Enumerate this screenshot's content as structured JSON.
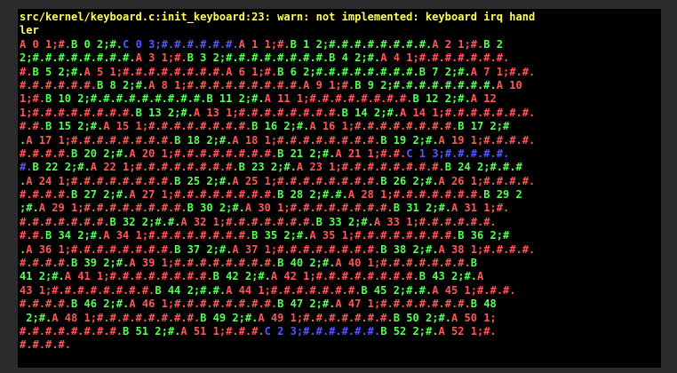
{
  "window": {
    "title": ""
  },
  "colors": {
    "background": "#000000",
    "frame": "#2b2b2b",
    "warn": "#ffff55",
    "task_a": "#ff5555",
    "task_b": "#55ff55",
    "task_c": "#5555ff"
  },
  "console": {
    "lines": [
      [
        {
          "t": "src/kernel/keyboard.c:init_keyboard:23: warn: not implemented: keyboard irq hand",
          "c": "warn"
        }
      ],
      [
        {
          "t": "ler",
          "c": "warn"
        }
      ],
      [
        {
          "t": "A 0 1;#.",
          "c": "r"
        },
        {
          "t": "B 0 2;#.",
          "c": "g"
        },
        {
          "t": "C 0 3;#.#.#.#.#.#.",
          "c": "b"
        },
        {
          "t": "A 1 1;#.",
          "c": "r"
        },
        {
          "t": "B 1 2;#.#.#.#.#.#.#.#.",
          "c": "g"
        },
        {
          "t": "A 2 1;#.",
          "c": "r"
        },
        {
          "t": "B 2",
          "c": "g"
        }
      ],
      [
        {
          "t": "2;#.#.#.#.#.#.#.#.",
          "c": "g"
        },
        {
          "t": "A 3 1;#.",
          "c": "r"
        },
        {
          "t": "B 3 2;#.#.#.#.#.#.#.#.",
          "c": "g"
        },
        {
          "t": "B 4 2;#.",
          "c": "g"
        },
        {
          "t": "A 4 1;#.#.#.#.#.#.#.",
          "c": "r"
        }
      ],
      [
        {
          "t": "#.",
          "c": "r"
        },
        {
          "t": "B 5 2;#.",
          "c": "g"
        },
        {
          "t": "A 5 1;#.#.#.#.#.#.#.#.",
          "c": "r"
        },
        {
          "t": "A 6 1;#.",
          "c": "r"
        },
        {
          "t": "B 6 2;#.#.#.#.#.#.#.#.",
          "c": "g"
        },
        {
          "t": "B 7 2;#.",
          "c": "g"
        },
        {
          "t": "A 7 1;#.#.",
          "c": "r"
        }
      ],
      [
        {
          "t": "#.#.#.#.#.#.",
          "c": "r"
        },
        {
          "t": "B 8 2;#.",
          "c": "g"
        },
        {
          "t": "A 8 1;#.#.#.#.#.#.#.#.#.",
          "c": "r"
        },
        {
          "t": "A 9 1;#.",
          "c": "r"
        },
        {
          "t": "B 9 2;#.#.#.#.#.#.#.#.",
          "c": "g"
        },
        {
          "t": "A 10",
          "c": "r"
        }
      ],
      [
        {
          "t": "1;#.",
          "c": "r"
        },
        {
          "t": "B 10 2;#.#.#.#.#.#.#.#.#.",
          "c": "g"
        },
        {
          "t": "B 11 2;#.",
          "c": "g"
        },
        {
          "t": "A 11 1;#.#.#.#.#.#.#.#.",
          "c": "r"
        },
        {
          "t": "B 12 2;#.",
          "c": "g"
        },
        {
          "t": "A 12",
          "c": "r"
        }
      ],
      [
        {
          "t": "1;#.#.#.#.#.#.#.#.",
          "c": "r"
        },
        {
          "t": "B 13 2;#.",
          "c": "g"
        },
        {
          "t": "A 13 1;#.#.#.#.#.#.#.#.",
          "c": "r"
        },
        {
          "t": "B 14 2;#.",
          "c": "g"
        },
        {
          "t": "A 14 1;#.#.#.#.#.#.#.",
          "c": "r"
        }
      ],
      [
        {
          "t": "#.#.",
          "c": "r"
        },
        {
          "t": "B 15 2;#.",
          "c": "g"
        },
        {
          "t": "A 15 1;#.#.#.#.#.#.#.#.",
          "c": "r"
        },
        {
          "t": "B 16 2;#.",
          "c": "g"
        },
        {
          "t": "A 16 1;#.#.#.#.#.#.#.#.",
          "c": "r"
        },
        {
          "t": "B 17 2;#",
          "c": "g"
        }
      ],
      [
        {
          "t": ".",
          "c": "g"
        },
        {
          "t": "A 17 1;#.#.#.#.#.#.#.#.",
          "c": "r"
        },
        {
          "t": "B 18 2;#.",
          "c": "g"
        },
        {
          "t": "A 18 1;#.#.#.#.#.#.#.#.",
          "c": "r"
        },
        {
          "t": "B 19 2;#.",
          "c": "g"
        },
        {
          "t": "A 19 1;#.#.#.#.",
          "c": "r"
        }
      ],
      [
        {
          "t": "#.#.#.#.",
          "c": "r"
        },
        {
          "t": "B 20 2;#.",
          "c": "g"
        },
        {
          "t": "A 20 1;#.#.#.#.#.#.#.#.",
          "c": "r"
        },
        {
          "t": "B 21 2;#.",
          "c": "g"
        },
        {
          "t": "A 21 1;#.#.",
          "c": "r"
        },
        {
          "t": "C 1 3;#.#.#.#.#.",
          "c": "b"
        }
      ],
      [
        {
          "t": "#.",
          "c": "b"
        },
        {
          "t": "B 22 2;#.",
          "c": "g"
        },
        {
          "t": "A 22 1;#.#.#.#.#.#.#.#.",
          "c": "r"
        },
        {
          "t": "B 23 2;#.",
          "c": "g"
        },
        {
          "t": "A 23 1;#.#.#.#.#.#.#.#.",
          "c": "r"
        },
        {
          "t": "B 24 2;#.#.#",
          "c": "g"
        }
      ],
      [
        {
          "t": ".",
          "c": "g"
        },
        {
          "t": "A 24 1;#.#.#.#.#.#.#.#.",
          "c": "r"
        },
        {
          "t": "B 25 2;#.",
          "c": "g"
        },
        {
          "t": "A 25 1;#.#.#.#.#.#.#.#.",
          "c": "r"
        },
        {
          "t": "B 26 2;#.",
          "c": "g"
        },
        {
          "t": "A 26 1;#.#.#.#.",
          "c": "r"
        }
      ],
      [
        {
          "t": "#.#.#.#.",
          "c": "r"
        },
        {
          "t": "B 27 2;#.",
          "c": "g"
        },
        {
          "t": "A 27 1;#.#.#.#.#.#.#.#.",
          "c": "r"
        },
        {
          "t": "B 28 2;#.#.",
          "c": "g"
        },
        {
          "t": "A 28 1;#.#.#.#.#.#.#.",
          "c": "r"
        },
        {
          "t": "B 29 2",
          "c": "g"
        }
      ],
      [
        {
          "t": ";#.",
          "c": "g"
        },
        {
          "t": "A 29 1;#.#.#.#.#.#.#.#.",
          "c": "r"
        },
        {
          "t": "B 30 2;#.",
          "c": "g"
        },
        {
          "t": "A 30 1;#.#.#.#.#.#.#.#.",
          "c": "r"
        },
        {
          "t": "B 31 2;#.",
          "c": "g"
        },
        {
          "t": "A 31 1;#.",
          "c": "r"
        }
      ],
      [
        {
          "t": "#.#.#.#.#.#.#.",
          "c": "r"
        },
        {
          "t": "B 32 2;#.#.",
          "c": "g"
        },
        {
          "t": "A 32 1;#.#.#.#.#.#.#.",
          "c": "r"
        },
        {
          "t": "B 33 2;#.",
          "c": "g"
        },
        {
          "t": "A 33 1;#.#.#.#.#.#.",
          "c": "r"
        }
      ],
      [
        {
          "t": "#.#.",
          "c": "r"
        },
        {
          "t": "B 34 2;#.",
          "c": "g"
        },
        {
          "t": "A 34 1;#.#.#.#.#.#.#.#.",
          "c": "r"
        },
        {
          "t": "B 35 2;#.",
          "c": "g"
        },
        {
          "t": "A 35 1;#.#.#.#.#.#.#.#.",
          "c": "r"
        },
        {
          "t": "B 36 2;#",
          "c": "g"
        }
      ],
      [
        {
          "t": ".",
          "c": "g"
        },
        {
          "t": "A 36 1;#.#.#.#.#.#.#.#.",
          "c": "r"
        },
        {
          "t": "B 37 2;#.",
          "c": "g"
        },
        {
          "t": "A 37 1;#.#.#.#.#.#.#.#.",
          "c": "r"
        },
        {
          "t": "B 38 2;#.",
          "c": "g"
        },
        {
          "t": "A 38 1;#.#.#.#.",
          "c": "r"
        }
      ],
      [
        {
          "t": "#.#.#.#.",
          "c": "r"
        },
        {
          "t": "B 39 2;#.",
          "c": "g"
        },
        {
          "t": "A 39 1;#.#.#.#.#.#.#.#.",
          "c": "r"
        },
        {
          "t": "B 40 2;#.",
          "c": "g"
        },
        {
          "t": "A 40 1;#.#.#.#.#.#.#.",
          "c": "r"
        },
        {
          "t": "B",
          "c": "g"
        }
      ],
      [
        {
          "t": "41 2;#.",
          "c": "g"
        },
        {
          "t": "A 41 1;#.#.#.#.#.#.#.#.",
          "c": "r"
        },
        {
          "t": "B 42 2;#.",
          "c": "g"
        },
        {
          "t": "A 42 1;#.#.#.#.#.#.#.#.",
          "c": "r"
        },
        {
          "t": "B 43 2;#.",
          "c": "g"
        },
        {
          "t": "A",
          "c": "r"
        }
      ],
      [
        {
          "t": "43 1;#.#.#.#.#.#.#.#.",
          "c": "r"
        },
        {
          "t": "B 44 2;#.#.",
          "c": "g"
        },
        {
          "t": "A 44 1;#.#.#.#.#.#.#.",
          "c": "r"
        },
        {
          "t": "B 45 2;#.#.",
          "c": "g"
        },
        {
          "t": "A 45 1;#.#.#.",
          "c": "r"
        }
      ],
      [
        {
          "t": "#.#.#.#.",
          "c": "r"
        },
        {
          "t": "B 46 2;#.",
          "c": "g"
        },
        {
          "t": "A 46 1;#.#.#.#.#.#.#.#.",
          "c": "r"
        },
        {
          "t": "B 47 2;#.",
          "c": "g"
        },
        {
          "t": "A 47 1;#.#.#.#.#.#.#.",
          "c": "r"
        },
        {
          "t": "B 48",
          "c": "g"
        }
      ],
      [
        {
          "t": " 2;#.",
          "c": "g"
        },
        {
          "t": "A 48 1;#.#.#.#.#.#.#.#.",
          "c": "r"
        },
        {
          "t": "B 49 2;#.",
          "c": "g"
        },
        {
          "t": "A 49 1;#.#.#.#.#.#.#.",
          "c": "r"
        },
        {
          "t": "B 50 2;#.",
          "c": "g"
        },
        {
          "t": "A 50 1;",
          "c": "r"
        }
      ],
      [
        {
          "t": "#.#.#.#.#.#.#.#.",
          "c": "r"
        },
        {
          "t": "B 51 2;#.",
          "c": "g"
        },
        {
          "t": "A 51 1;#.#.#.",
          "c": "r"
        },
        {
          "t": "C 2 3;#.#.#.#.#.#.",
          "c": "b"
        },
        {
          "t": "B 52 2;#.",
          "c": "g"
        },
        {
          "t": "A 52 1;#.",
          "c": "r"
        }
      ],
      [
        {
          "t": "#.#.#.#.",
          "c": "r"
        }
      ]
    ]
  }
}
